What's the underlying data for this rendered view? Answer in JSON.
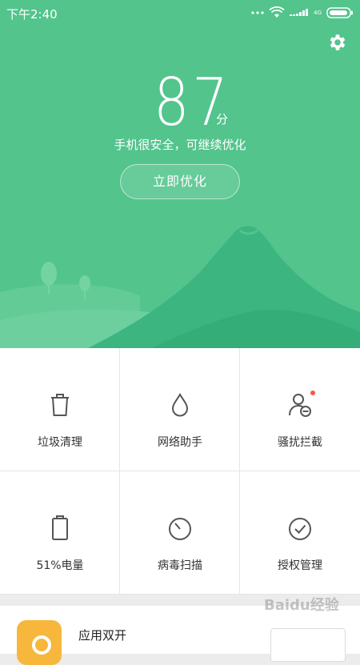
{
  "status_bar": {
    "time": "下午2:40",
    "network_label": "4G"
  },
  "security": {
    "score": "87",
    "unit": "分",
    "message": "手机很安全，可继续优化",
    "optimize_label": "立即优化"
  },
  "colors": {
    "accent": "#52c48c",
    "badge": "#f5584e",
    "app_icon": "#f6b73c"
  },
  "tools": [
    {
      "label": "垃圾清理",
      "icon": "trash-icon"
    },
    {
      "label": "网络助手",
      "icon": "drop-icon"
    },
    {
      "label": "骚扰拦截",
      "icon": "block-user-icon"
    },
    {
      "label": "51%电量",
      "icon": "battery-icon"
    },
    {
      "label": "病毒扫描",
      "icon": "scan-timer-icon"
    },
    {
      "label": "授权管理",
      "icon": "check-circle-icon"
    }
  ],
  "list": {
    "item_title": "应用双开"
  },
  "watermark": "Baidu经验"
}
